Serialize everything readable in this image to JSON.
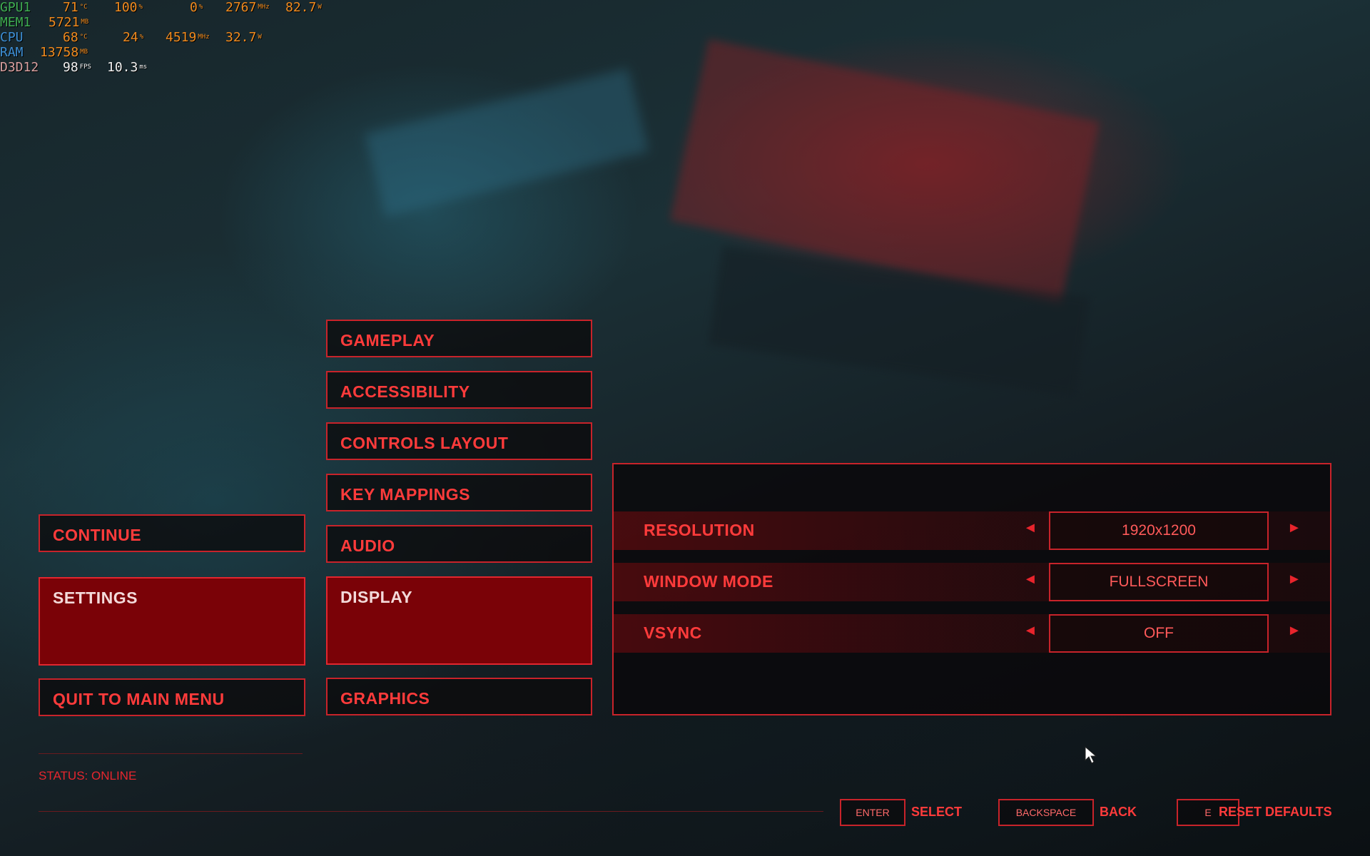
{
  "hud": {
    "gpu": {
      "label": "GPU1",
      "temp": "71",
      "temp_unit": "°C",
      "load": "100",
      "load_unit": "%",
      "fan": "0",
      "fan_unit": "%",
      "clock": "2767",
      "clock_unit": "MHz",
      "power": "82.7",
      "power_unit": "W"
    },
    "mem": {
      "label": "MEM1",
      "value": "5721",
      "unit": "MB"
    },
    "cpu": {
      "label": "CPU",
      "temp": "68",
      "temp_unit": "°C",
      "load": "24",
      "load_unit": "%",
      "clock": "4519",
      "clock_unit": "MHz",
      "power": "32.7",
      "power_unit": "W"
    },
    "ram": {
      "label": "RAM",
      "value": "13758",
      "unit": "MB"
    },
    "api": {
      "label": "D3D12",
      "fps": "98",
      "fps_unit": "FPS",
      "frametime": "10.3",
      "frametime_unit": "ms"
    }
  },
  "main_menu": {
    "continue": "CONTINUE",
    "settings": "SETTINGS",
    "quit": "QUIT TO MAIN MENU",
    "status": "STATUS: ONLINE"
  },
  "settings_menu": {
    "gameplay": "GAMEPLAY",
    "accessibility": "ACCESSIBILITY",
    "controls_layout": "CONTROLS LAYOUT",
    "key_mappings": "KEY MAPPINGS",
    "audio": "AUDIO",
    "display": "DISPLAY",
    "graphics": "GRAPHICS"
  },
  "display_panel": {
    "rows": [
      {
        "label": "RESOLUTION",
        "value": "1920x1200"
      },
      {
        "label": "WINDOW MODE",
        "value": "FULLSCREEN"
      },
      {
        "label": "VSYNC",
        "value": "OFF"
      }
    ],
    "left_arrow": "◄",
    "right_arrow": "►"
  },
  "footer": {
    "enter_key": "ENTER",
    "enter_action": "SELECT",
    "back_key": "BACKSPACE",
    "back_action": "BACK",
    "reset_key": "E",
    "reset_action": "RESET DEFAULTS"
  },
  "colors": {
    "accent": "#c8232a",
    "text": "#ff3b3b",
    "active_bg": "#7a0207"
  }
}
